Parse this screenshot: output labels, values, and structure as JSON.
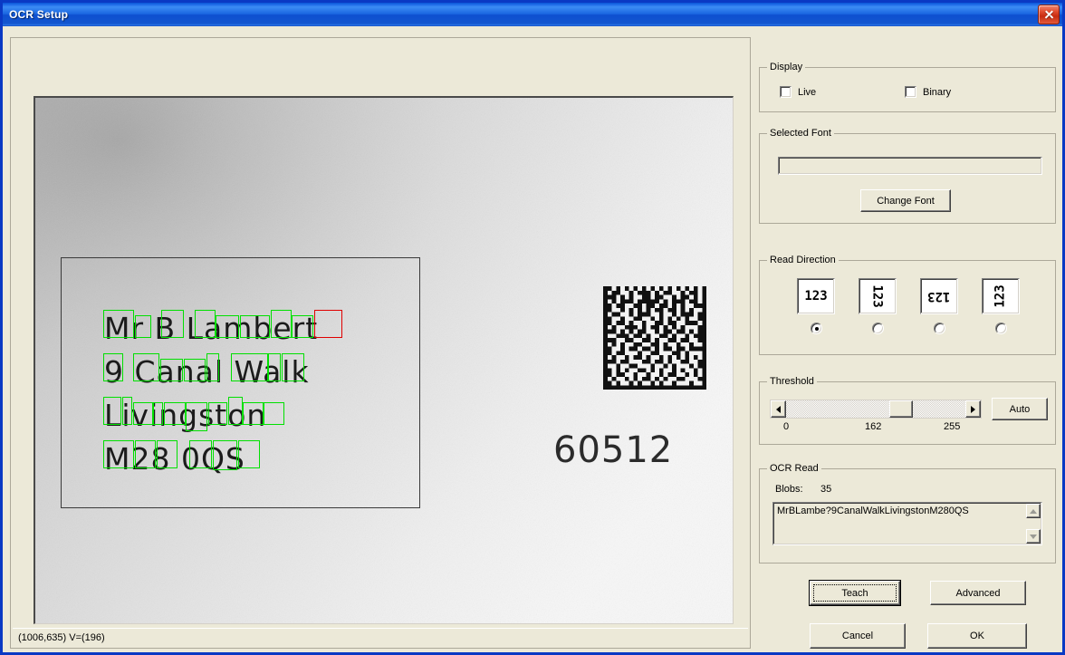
{
  "window": {
    "title": "OCR Setup",
    "close_label": "Close"
  },
  "image_panel": {
    "status_bar": "(1006,635)  V=(196)",
    "overlay_text_lines": [
      "Mr B Lambert",
      "9 Canal Walk",
      "Livingston",
      "M28 0QS"
    ],
    "part_number": "60512",
    "datamatrix_label": "datamatrix-code"
  },
  "display": {
    "title": "Display",
    "live_label": "Live",
    "live_checked": false,
    "binary_label": "Binary",
    "binary_checked": false
  },
  "selected_font": {
    "title": "Selected Font",
    "value": "",
    "change_font_label": "Change Font"
  },
  "read_direction": {
    "title": "Read Direction",
    "options": [
      {
        "glyph": "123",
        "rotation": 0,
        "selected": true
      },
      {
        "glyph": "123",
        "rotation": 90,
        "selected": false
      },
      {
        "glyph": "123",
        "rotation": 180,
        "selected": false
      },
      {
        "glyph": "123",
        "rotation": 270,
        "selected": false
      }
    ]
  },
  "threshold": {
    "title": "Threshold",
    "min_label": "0",
    "value_label": "162",
    "max_label": "255",
    "value": 162,
    "min": 0,
    "max": 255,
    "auto_label": "Auto"
  },
  "ocr_read": {
    "title": "OCR Read",
    "blobs_label": "Blobs:",
    "blobs_value": "35",
    "result_text": "MrBLambe?9CanalWalkLivingstonM280QS"
  },
  "buttons": {
    "teach": "Teach",
    "advanced": "Advanced",
    "cancel": "Cancel",
    "ok": "OK"
  },
  "colors": {
    "titlebar_blue": "#0a56d6",
    "dialog_face": "#ece9d8",
    "char_box_ok": "#00e000",
    "char_box_fail": "#e00000"
  }
}
